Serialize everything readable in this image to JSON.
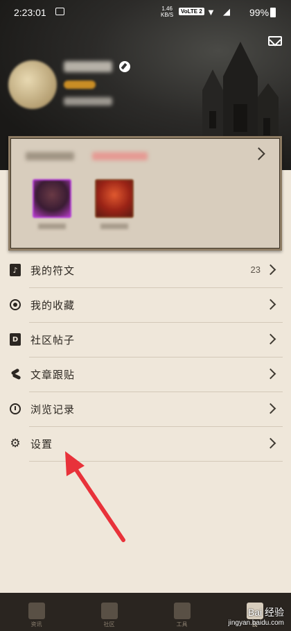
{
  "status_bar": {
    "time": "2:23:01",
    "net_speed": "1.46",
    "net_unit": "KB/S",
    "volte": "VoLTE 2",
    "battery_pct": "99%"
  },
  "profile": {
    "username": "",
    "level": "",
    "stats": ""
  },
  "card": {
    "title": "",
    "subtitle": "",
    "heroes": [
      "",
      ""
    ]
  },
  "menu": [
    {
      "label": "我的符文",
      "count": "23",
      "icon": "rune-icon"
    },
    {
      "label": "我的收藏",
      "count": "",
      "icon": "target-icon"
    },
    {
      "label": "社区帖子",
      "count": "",
      "icon": "post-icon"
    },
    {
      "label": "文章跟贴",
      "count": "",
      "icon": "article-icon"
    },
    {
      "label": "浏览记录",
      "count": "",
      "icon": "clock-icon"
    },
    {
      "label": "设置",
      "count": "",
      "icon": "gear-icon"
    }
  ],
  "bottom_nav": [
    {
      "label": "资讯"
    },
    {
      "label": "社区"
    },
    {
      "label": "工具"
    },
    {
      "label": "我"
    }
  ],
  "watermark": {
    "text": "Bai 经验",
    "url": "jingyan.baidu.com"
  },
  "colors": {
    "header_bg": "#1d1c1a",
    "page_bg": "#efe7da",
    "arrow": "#e8323a",
    "nav_bg": "#2a2520"
  }
}
